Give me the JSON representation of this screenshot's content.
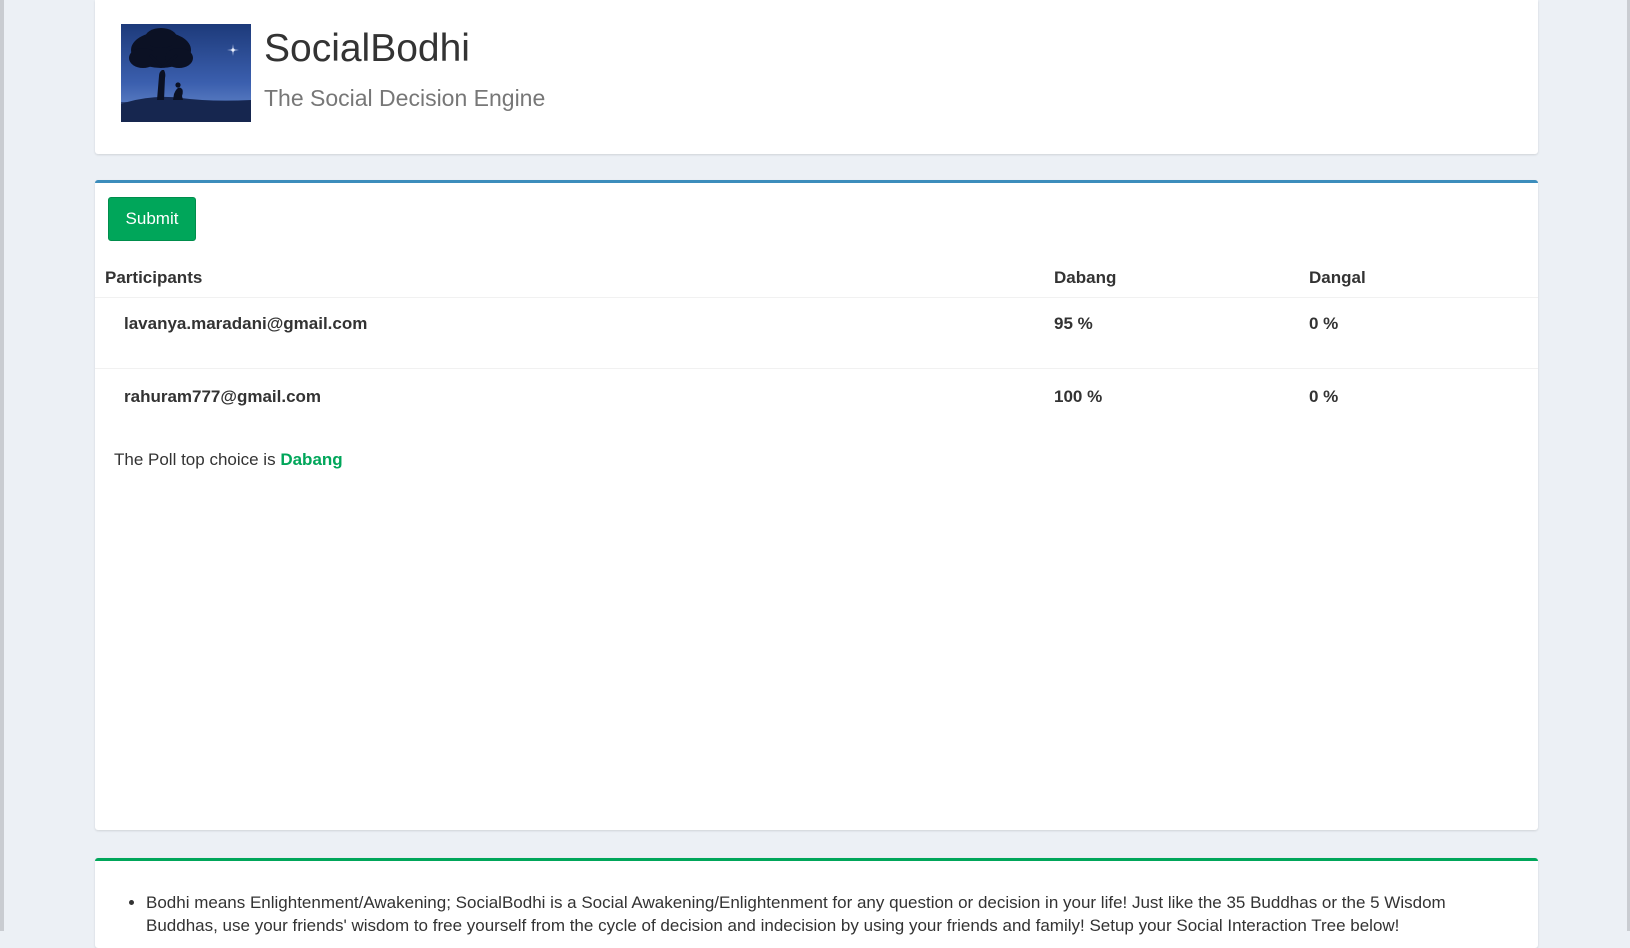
{
  "header": {
    "logo_label": "SocialBodhi logo - bodhi tree under night sky",
    "title": "SocialBodhi",
    "subtitle": "The Social Decision Engine"
  },
  "poll": {
    "submit_label": "Submit",
    "columns": [
      "Participants",
      "Dabang",
      "Dangal"
    ],
    "rows": [
      {
        "participant": "lavanya.maradani@gmail.com",
        "dabang": "95 %",
        "dangal": "0 %"
      },
      {
        "participant": "rahuram777@gmail.com",
        "dabang": "100 %",
        "dangal": "0 %"
      }
    ],
    "top_choice_prefix": "The Poll top choice is",
    "top_choice_value": "Dabang"
  },
  "info": {
    "items": [
      "Bodhi means Enlightenment/Awakening; SocialBodhi is a Social Awakening/Enlightenment for any question or decision in your life! Just like the 35 Buddhas or the 5 Wisdom Buddhas, use your friends' wisdom to free yourself from the cycle of decision and indecision by using your friends and family! Setup your Social Interaction Tree below!"
    ]
  },
  "colors": {
    "background": "#ecf0f5",
    "primary_border": "#3c8dbc",
    "success": "#00a65a"
  }
}
